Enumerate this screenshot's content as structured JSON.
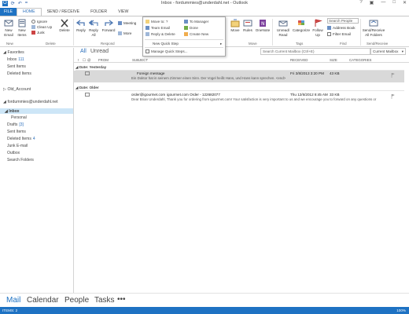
{
  "window": {
    "title": "Inbox - fordummies@underdahl.net - Outlook",
    "account": "fordummies@underdahl.net"
  },
  "tabs": [
    "FILE",
    "HOME",
    "SEND / RECEIVE",
    "FOLDER",
    "VIEW"
  ],
  "ribbon": {
    "new_email": "New Email",
    "new_items": "New Items",
    "ignore": "Ignore",
    "clean_up": "Clean Up",
    "junk": "Junk",
    "delete": "Delete",
    "reply": "Reply",
    "reply_all": "Reply All",
    "forward": "Forward",
    "meeting": "Meeting",
    "more": "More",
    "move": "Move",
    "rules": "Rules",
    "onenote": "OneNote",
    "unread_read": "Unread/ Read",
    "categorize": "Categorize",
    "follow_up": "Follow Up",
    "search_people": "Search People",
    "address_book": "Address Book",
    "filter_email": "Filter Email",
    "send_receive_all": "Send/Receive All Folders",
    "groups": [
      "New",
      "Delete",
      "Respond",
      "Move",
      "Tags",
      "Find",
      "Send/Receive"
    ]
  },
  "quick_steps": {
    "items": [
      "Move to: ?",
      "To Manager",
      "Team Email",
      "Done",
      "Reply & Delete",
      "Create New"
    ],
    "new_quick_step": "New Quick Step",
    "manage": "Manage Quick Steps..."
  },
  "filter": {
    "all": "All",
    "unread": "Unread"
  },
  "search": {
    "placeholder": "Search Current Mailbox (Ctrl+E)",
    "scope": "Current Mailbox"
  },
  "folders": {
    "favorites": "Favorites",
    "fav_items": [
      {
        "label": "Inbox",
        "count": "111"
      },
      {
        "label": "Sent Items",
        "count": ""
      },
      {
        "label": "Deleted Items",
        "count": ""
      }
    ],
    "old_account": "Old_Account",
    "account": "fordummies@underdahl.net",
    "inbox": "Inbox",
    "items": [
      {
        "label": "Personal",
        "count": ""
      },
      {
        "label": "Drafts",
        "count": "[3]"
      },
      {
        "label": "Sent Items",
        "count": ""
      },
      {
        "label": "Deleted Items",
        "count": "4"
      },
      {
        "label": "Junk E-mail",
        "count": ""
      },
      {
        "label": "Outbox",
        "count": ""
      },
      {
        "label": "Search Folders",
        "count": ""
      }
    ]
  },
  "columns": [
    "FROM",
    "SUBJECT",
    "RECEIVED",
    "SIZE",
    "CATEGORIES"
  ],
  "groups": [
    {
      "header": "Date: Yesterday",
      "messages": [
        {
          "from": "",
          "subject": "Foreign message",
          "preview": "Ein Doktor hat in seinem Zimmer einen Sinn. Der Vogel heißt Hans, und Hans kann sprechen. <end>",
          "received": "Fri 3/8/2013 3:20 PM",
          "size": "43 KB"
        }
      ]
    },
    {
      "header": "Date: Older",
      "messages": [
        {
          "from": "order@igourmet.com",
          "subject": "igourmet.com Order - 122682077",
          "preview": "Dear Brian Underdahl, Thank you for ordering from igourmet.com! Your satisfaction is very important to us and we encourage you to forward on any questions or",
          "received": "Thu 12/6/2012 8:45 AM",
          "size": "33 KB"
        }
      ]
    }
  ],
  "nav": [
    "Mail",
    "Calendar",
    "People",
    "Tasks",
    "•••"
  ],
  "status": {
    "items": "ITEMS: 2",
    "zoom": "100%"
  },
  "colors": {
    "accent": "#1e72c3",
    "selected": "#cde6f7"
  }
}
